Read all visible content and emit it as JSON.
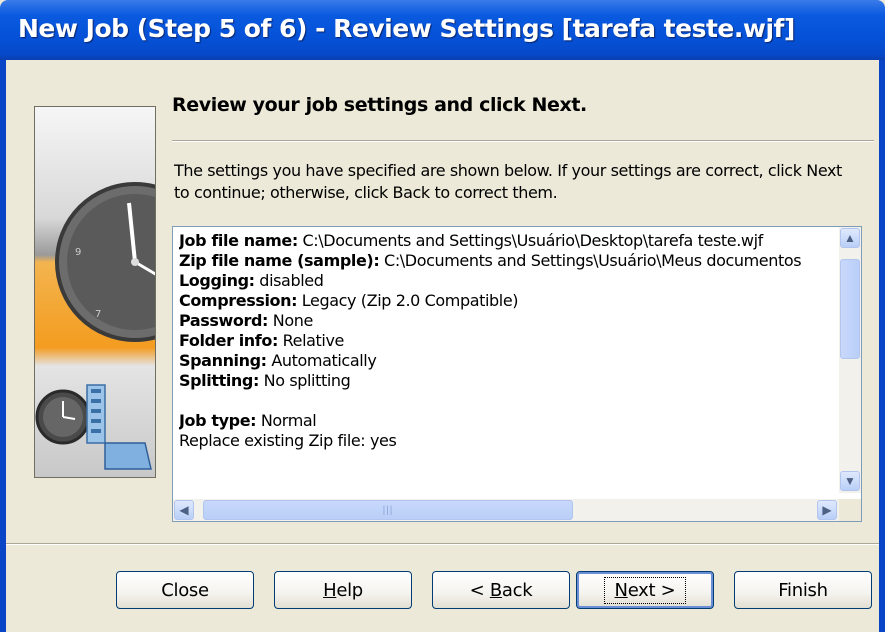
{
  "window": {
    "title": "New Job (Step 5 of 6) - Review Settings [tarefa teste.wjf]"
  },
  "main": {
    "heading": "Review your job settings and click Next.",
    "description": "The settings you have specified are shown below.  If your settings are correct, click Next to continue; otherwise, click Back to correct them."
  },
  "settings": [
    {
      "label": "Job file name:",
      "value": " C:\\Documents and Settings\\Usuário\\Desktop\\tarefa teste.wjf"
    },
    {
      "label": "Zip file name (sample):",
      "value": " C:\\Documents and Settings\\Usuário\\Meus documentos"
    },
    {
      "label": "Logging:",
      "value": " disabled"
    },
    {
      "label": "Compression:",
      "value": " Legacy (Zip 2.0 Compatible)"
    },
    {
      "label": "Password:",
      "value": " None"
    },
    {
      "label": "Folder info:",
      "value": " Relative"
    },
    {
      "label": "Spanning:",
      "value": " Automatically"
    },
    {
      "label": "Splitting:",
      "value": " No splitting"
    },
    {
      "label": "Job type:",
      "value": " Normal"
    },
    {
      "label": "",
      "value": "    Replace existing Zip file: yes"
    }
  ],
  "buttons": {
    "close": "Close",
    "help_underline": "H",
    "help_rest": "elp",
    "back_prefix": "< ",
    "back_underline": "B",
    "back_rest": "ack",
    "next_underline": "N",
    "next_rest": "ext >",
    "finish": "Finish"
  },
  "colors": {
    "titlebar": "#0552d8",
    "dialog_bg": "#ece9d8",
    "list_border": "#7f9db9"
  }
}
